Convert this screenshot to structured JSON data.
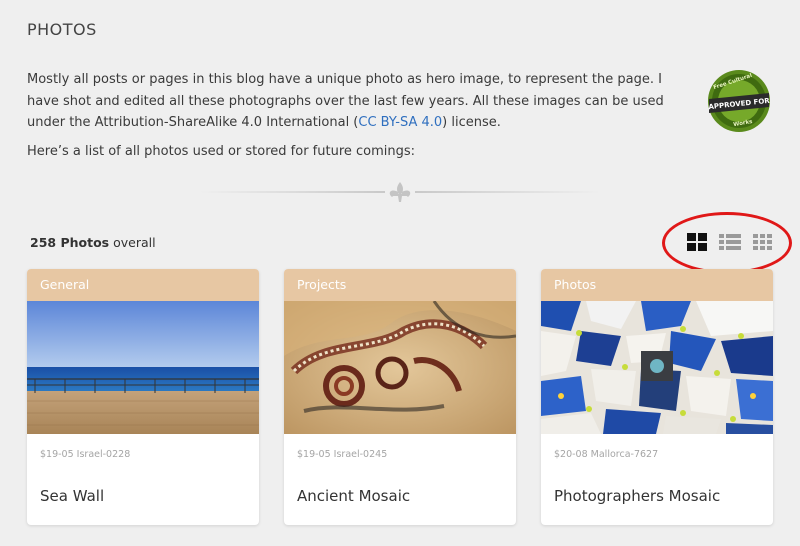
{
  "page": {
    "title": "PHOTOS",
    "intro_before_link": "Mostly all posts or pages in this blog have a unique photo as hero image, to represent the page. I have shot and edited all these photographs over the last few years. All these images can be used under the Attribution-ShareAlike 4.0 International (",
    "license_link": "CC BY-SA 4.0",
    "intro_after_link": ") license.",
    "list_intro": "Here’s a list of all photos used or stored for future comings:",
    "badge": {
      "top_text": "Free Cultural",
      "center_text": "APPROVED FOR",
      "bottom_text": "Works",
      "icon": "free-cultural-works-badge"
    }
  },
  "gallery": {
    "count_number": "258 Photos",
    "count_suffix": "overall",
    "view_modes": [
      {
        "name": "grid-large",
        "icon": "grid-large-icon",
        "active": true
      },
      {
        "name": "list",
        "icon": "list-icon",
        "active": false
      },
      {
        "name": "grid-small",
        "icon": "grid-small-icon",
        "active": false
      }
    ],
    "cards": [
      {
        "category": "General",
        "meta": "$19-05 Israel-0228",
        "title": "Sea Wall"
      },
      {
        "category": "Projects",
        "meta": "$19-05 Israel-0245",
        "title": "Ancient Mosaic"
      },
      {
        "category": "Photos",
        "meta": "$20-08 Mallorca-7627",
        "title": "Photographers Mosaic"
      }
    ]
  },
  "colors": {
    "accent_header": "#e7c7a3",
    "link": "#2f6fbf",
    "highlight_circle": "#e01818",
    "background": "#efefef"
  }
}
